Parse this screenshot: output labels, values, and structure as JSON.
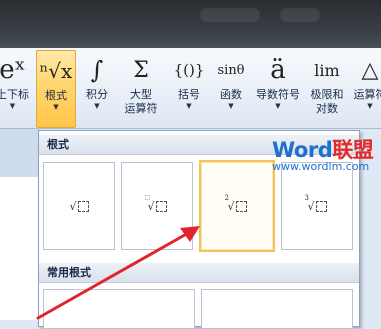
{
  "ribbon": {
    "buttons": [
      {
        "icon": "eˣ",
        "label": "上下标",
        "label2": ""
      },
      {
        "icon": "ⁿ√x",
        "label": "根式",
        "label2": ""
      },
      {
        "icon": "∫",
        "label": "积分",
        "label2": ""
      },
      {
        "icon": "Σ",
        "label": "大型",
        "label2": "运算符"
      },
      {
        "icon": "{()}",
        "label": "括号",
        "label2": ""
      },
      {
        "icon": "sinθ",
        "label": "函数",
        "label2": ""
      },
      {
        "icon": "ä",
        "label": "导数符号",
        "label2": ""
      },
      {
        "icon": "lim",
        "label": "极限和",
        "label2": "对数"
      },
      {
        "icon": "△",
        "label": "运算符",
        "label2": ""
      }
    ]
  },
  "panel": {
    "section1_title": "根式",
    "section2_title": "常用根式",
    "tiles": [
      {
        "index": "",
        "name": "square-root"
      },
      {
        "index": "⬚",
        "name": "nth-root"
      },
      {
        "index": "2",
        "name": "square-root-with-degree"
      },
      {
        "index": "3",
        "name": "cube-root"
      }
    ]
  },
  "watermark": {
    "brand_a": "Word",
    "brand_b": "联盟",
    "url": "www.wordlm.com"
  },
  "colors": {
    "accent": "#ffd66e",
    "arrow": "#e0262b",
    "watermark_blue": "#1f6fcf",
    "watermark_red": "#e22a2a"
  }
}
